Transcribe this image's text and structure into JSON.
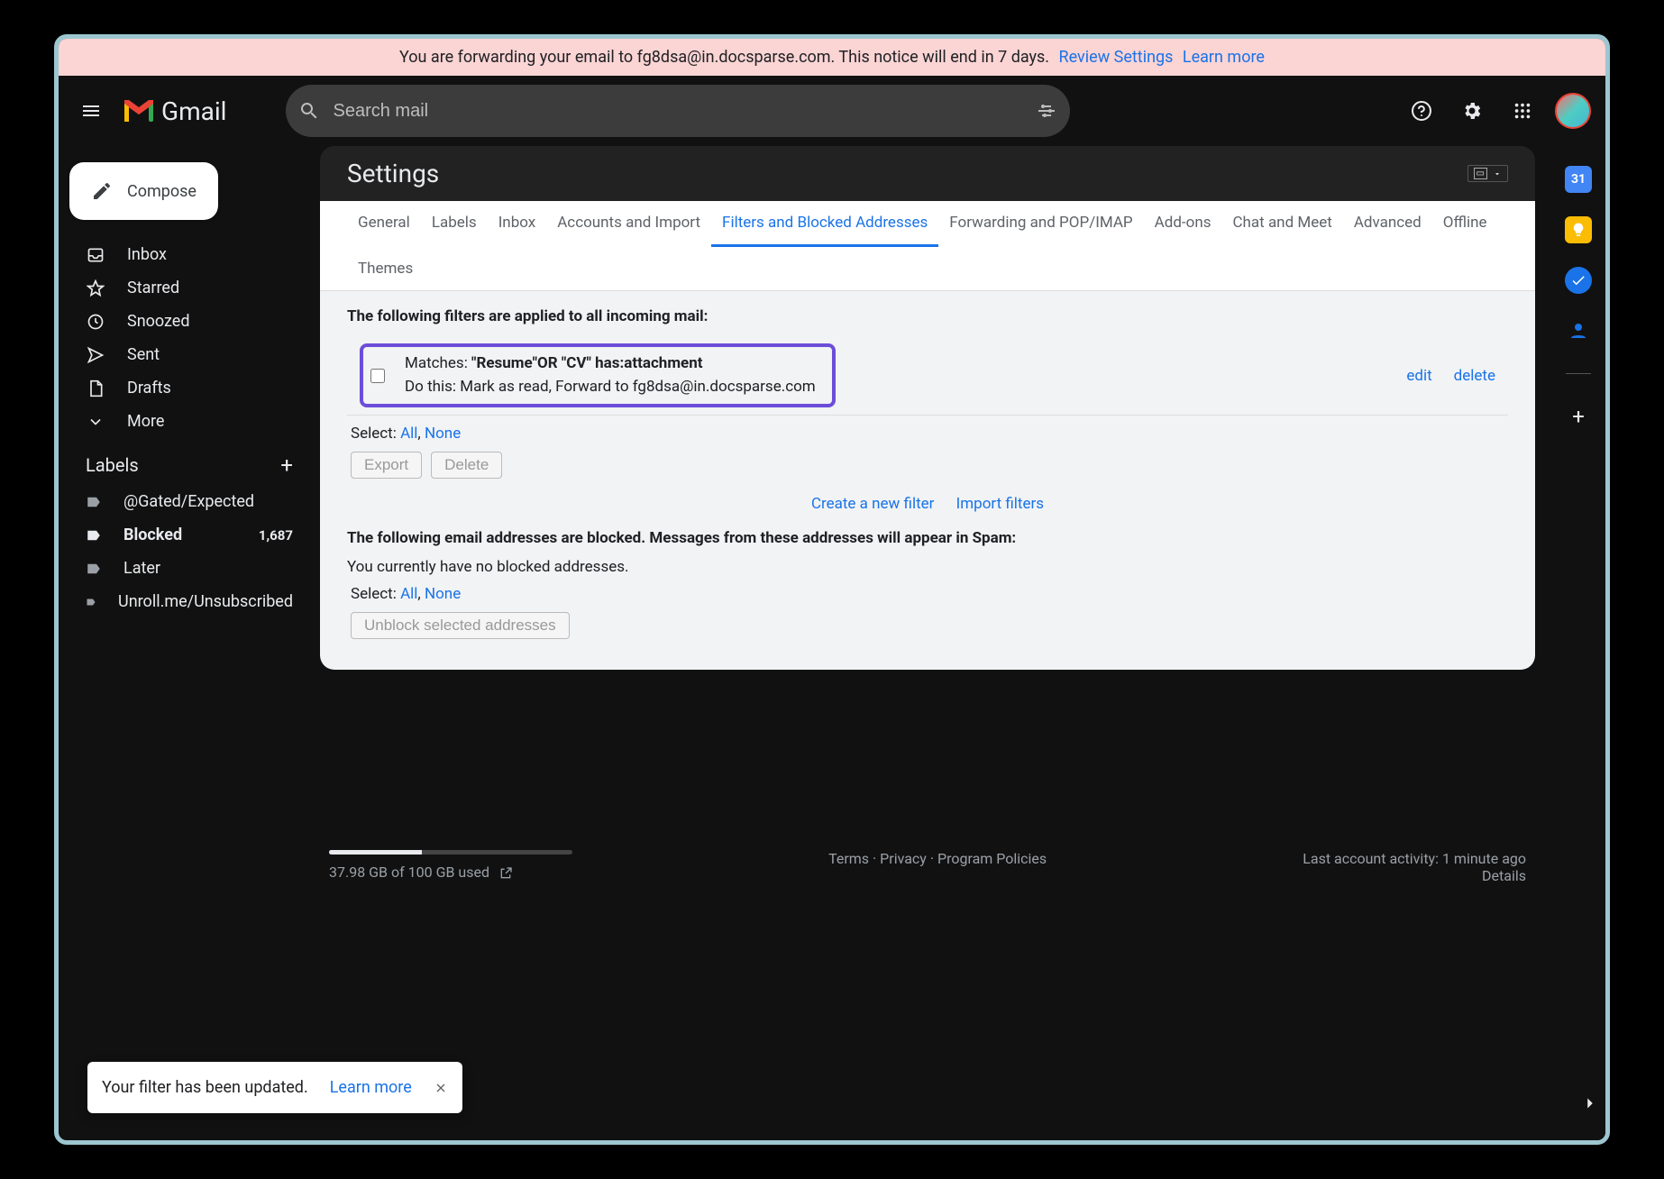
{
  "banner": {
    "text": "You are forwarding your email to fg8dsa@in.docsparse.com. This notice will end in 7 days.",
    "review": "Review Settings",
    "learn": "Learn more"
  },
  "header": {
    "product": "Gmail",
    "search_placeholder": "Search mail"
  },
  "compose": "Compose",
  "nav": {
    "inbox": "Inbox",
    "starred": "Starred",
    "snoozed": "Snoozed",
    "sent": "Sent",
    "drafts": "Drafts",
    "more": "More"
  },
  "labels_header": "Labels",
  "labels": [
    {
      "name": "@Gated/Expected",
      "count": "",
      "bold": false
    },
    {
      "name": "Blocked",
      "count": "1,687",
      "bold": true
    },
    {
      "name": "Later",
      "count": "",
      "bold": false
    },
    {
      "name": "Unroll.me/Unsubscribed",
      "count": "",
      "bold": false
    }
  ],
  "settings_title": "Settings",
  "tabs": [
    "General",
    "Labels",
    "Inbox",
    "Accounts and Import",
    "Filters and Blocked Addresses",
    "Forwarding and POP/IMAP",
    "Add-ons",
    "Chat and Meet",
    "Advanced",
    "Offline",
    "Themes"
  ],
  "active_tab": "Filters and Blocked Addresses",
  "filters_intro": "The following filters are applied to all incoming mail:",
  "filter": {
    "matches_label": "Matches: ",
    "matches_value": "\"Resume\"OR \"CV\" has:attachment",
    "dothis": "Do this: Mark as read, Forward to fg8dsa@in.docsparse.com",
    "edit": "edit",
    "delete": "delete"
  },
  "select": {
    "label": "Select: ",
    "all": "All",
    "none": "None",
    "sep": ", "
  },
  "buttons": {
    "export": "Export",
    "delete": "Delete",
    "unblock": "Unblock selected addresses"
  },
  "links": {
    "create": "Create a new filter",
    "import": "Import filters"
  },
  "blocked_intro": "The following email addresses are blocked. Messages from these addresses will appear in Spam:",
  "no_blocked": "You currently have no blocked addresses.",
  "storage": {
    "text": "37.98 GB of 100 GB used",
    "percent": 38
  },
  "footer_center": {
    "terms": "Terms",
    "privacy": "Privacy",
    "program": "Program Policies"
  },
  "footer_right": {
    "activity": "Last account activity: 1 minute ago",
    "details": "Details"
  },
  "calendar_day": "31",
  "toast": {
    "msg": "Your filter has been updated.",
    "learn": "Learn more"
  }
}
